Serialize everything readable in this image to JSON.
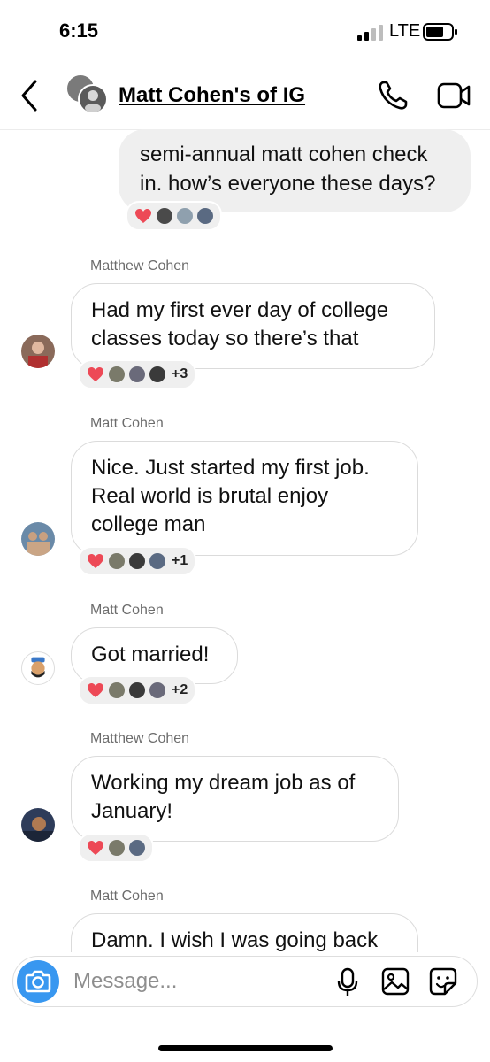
{
  "status_bar": {
    "time": "6:15",
    "network": "LTE"
  },
  "header": {
    "title": "Matt Cohen's of IG"
  },
  "messages": [
    {
      "type": "outgoing",
      "text_lines": [
        "semi-annual matt cohen check",
        "in. how’s everyone these days?"
      ]
    },
    {
      "type": "incoming",
      "sender": "Matthew Cohen",
      "text_lines": [
        "Had my first ever day of college",
        "classes today so there’s that"
      ],
      "reactions_more": "+3"
    },
    {
      "type": "incoming",
      "sender": "Matt Cohen",
      "text_lines": [
        "Nice. Just started my first job.",
        "Real world is brutal enjoy",
        "college man"
      ],
      "reactions_more": "+1"
    },
    {
      "type": "incoming",
      "sender": "Matt Cohen",
      "text_lines": [
        "Got married!"
      ],
      "reactions_more": "+2"
    },
    {
      "type": "incoming",
      "sender": "Matthew Cohen",
      "text_lines": [
        "Working my dream job as of",
        "January!"
      ]
    },
    {
      "type": "incoming",
      "sender": "Matt Cohen",
      "text_lines": [
        "Damn. I wish I was going back"
      ]
    }
  ],
  "composer": {
    "placeholder": "Message..."
  },
  "colors": {
    "accent": "#3897f0",
    "heart": "#ed4956",
    "outgoing_bubble": "#efefef"
  },
  "icons": [
    "back-chevron-icon",
    "phone-icon",
    "video-camera-icon",
    "camera-icon",
    "microphone-icon",
    "gallery-icon",
    "sticker-icon",
    "heart-icon"
  ]
}
